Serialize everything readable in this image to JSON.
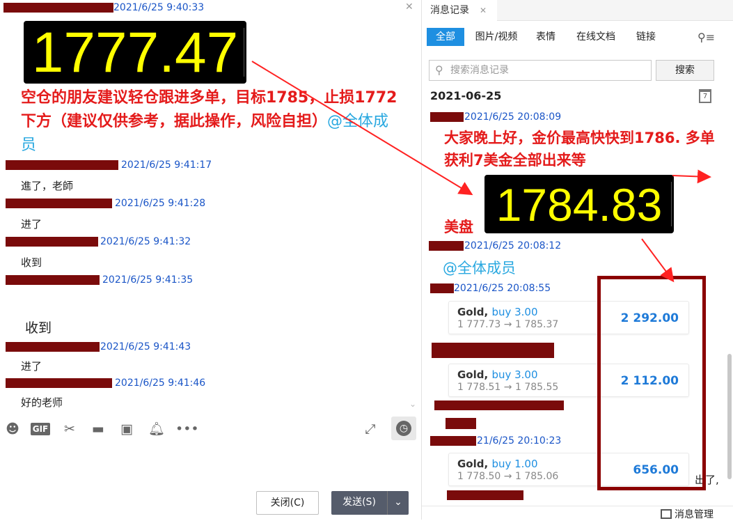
{
  "left": {
    "first_ts": "2021/6/25 9:40:33",
    "price_display": "1777.47",
    "announcement": "空仓的朋友建议轻仓跟进多单，目标1785，止损1772下方（建议仅供参考，据此操作，风险自担）",
    "mention": "@全体成员",
    "messages": [
      {
        "ts": "2021/6/25 9:41:17",
        "text": "進了，老師"
      },
      {
        "ts": "2021/6/25 9:41:28",
        "text": "进了"
      },
      {
        "ts": "2021/6/25 9:41:32",
        "text": "收到"
      },
      {
        "ts": "2021/6/25 9:41:35",
        "text": "收到"
      },
      {
        "ts": "2021/6/25 9:41:43",
        "text": "进了"
      },
      {
        "ts": "2021/6/25 9:41:46",
        "text": "好的老师"
      }
    ],
    "close_button": "关闭(C)",
    "send_button": "发送(S)"
  },
  "right": {
    "panel_title": "消息记录",
    "filter_tabs": [
      "全部",
      "图片/视频",
      "表情",
      "在线文档",
      "链接"
    ],
    "search_placeholder": "搜索消息记录",
    "search_button": "搜索",
    "date_header": "2021-06-25",
    "calendar_day": "7",
    "msg1_ts": "2021/6/25 20:08:09",
    "msg1_text": "大家晚上好，金价最高快快到1786. 多单获利7美金全部出来等",
    "msg1_text_tail": "美盘",
    "price_display": "1784.83",
    "msg2_ts": "2021/6/25 20:08:12",
    "msg2_mention": "@全体成员",
    "msg3_ts": "2021/6/25 20:08:55",
    "msg4_ts": "21/6/25 20:10:23",
    "trailing_text": "出了,",
    "manage_label": "消息管理",
    "trades": [
      {
        "symbol": "Gold,",
        "side": "buy 3.00",
        "range": "1 777.73 → 1 785.37",
        "pnl": "2 292.00"
      },
      {
        "symbol": "Gold,",
        "side": "buy 3.00",
        "range": "1 778.51 → 1 785.55",
        "pnl": "2 112.00"
      },
      {
        "symbol": "Gold,",
        "side": "buy 1.00",
        "range": "1 778.50 → 1 785.06",
        "pnl": "656.00"
      }
    ]
  },
  "colors": {
    "annotation_red": "#e41b1b",
    "redact": "#7a0b0b",
    "box_border": "#8b0000",
    "link_blue": "#1a55c7",
    "accent": "#1e8fe1"
  }
}
